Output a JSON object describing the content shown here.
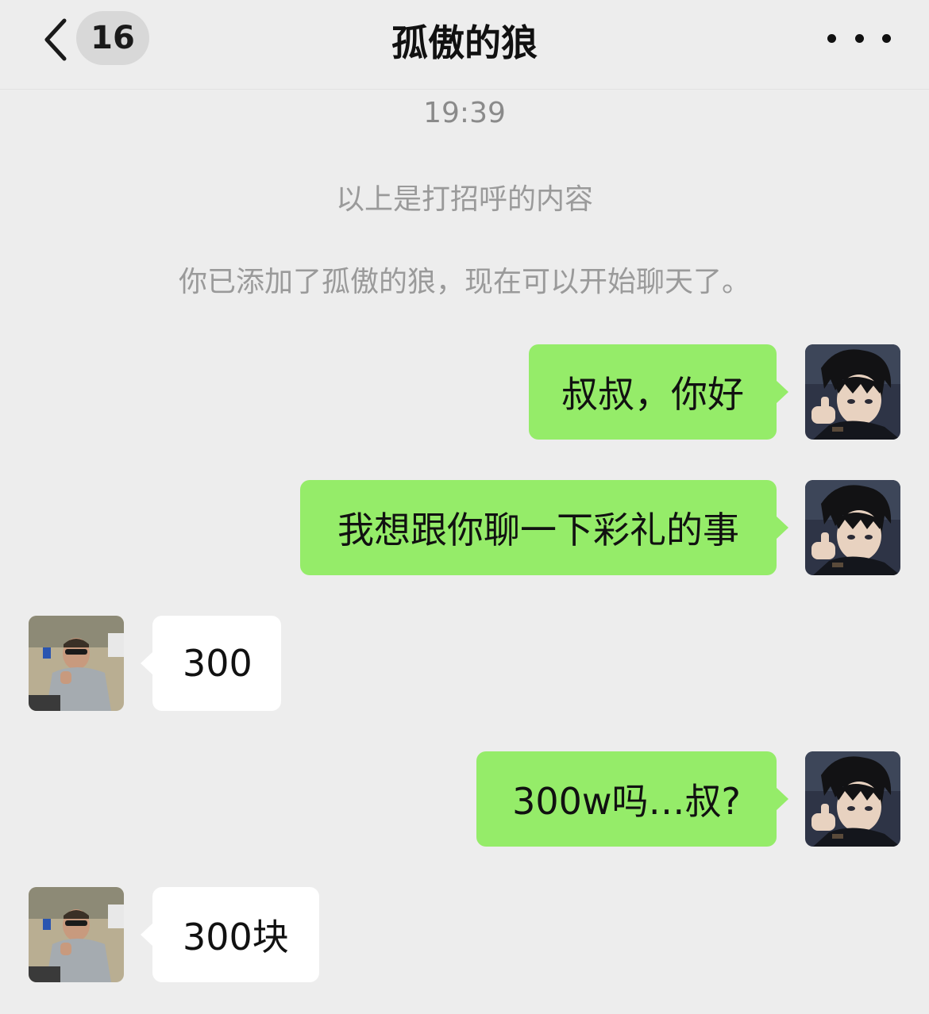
{
  "header": {
    "back_icon": "chevron-left-icon",
    "unread_count": "16",
    "title": "孤傲的狼",
    "more_icon": "more-dots-icon"
  },
  "chat": {
    "timestamp": "19:39",
    "system_messages": [
      "以上是打招呼的内容",
      "你已添加了孤傲的狼，现在可以开始聊天了。"
    ],
    "messages": [
      {
        "direction": "outgoing",
        "text": "叔叔，你好"
      },
      {
        "direction": "outgoing",
        "text": "我想跟你聊一下彩礼的事"
      },
      {
        "direction": "incoming",
        "text": "300"
      },
      {
        "direction": "outgoing",
        "text": "300w吗…叔?"
      },
      {
        "direction": "incoming",
        "text": "300块"
      }
    ]
  },
  "colors": {
    "background": "#ededed",
    "outgoing_bubble": "#95ec69",
    "incoming_bubble": "#ffffff",
    "system_text": "#9a9a9a"
  }
}
